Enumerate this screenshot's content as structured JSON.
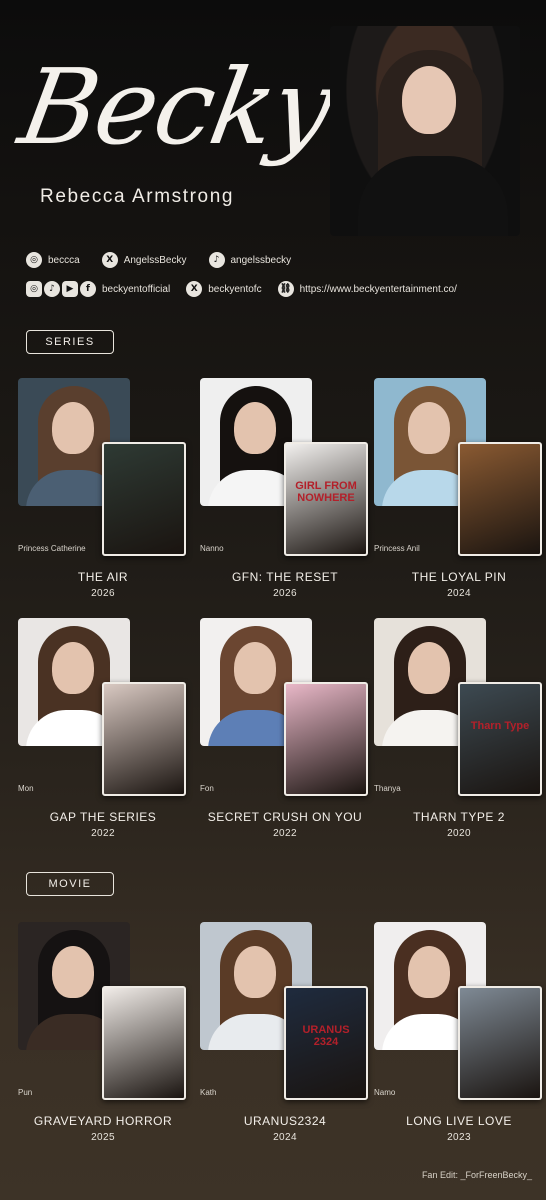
{
  "header": {
    "title": "Becky",
    "full_name": "Rebecca Armstrong"
  },
  "social": {
    "row1": [
      {
        "icon": "instagram-icon",
        "glyph": "◎",
        "handle": "beccca"
      },
      {
        "icon": "x-icon",
        "glyph": "X",
        "handle": "AngelssBecky"
      },
      {
        "icon": "tiktok-icon",
        "glyph": "♪",
        "handle": "angelssbecky"
      }
    ],
    "row2": [
      {
        "icon": "official-accounts-icons",
        "glyphs": [
          "◎",
          "♪",
          "▶",
          "f"
        ],
        "handle": "beckyentofficial"
      },
      {
        "icon": "x-icon",
        "glyph": "X",
        "handle": "beckyentofc"
      },
      {
        "icon": "link-icon",
        "glyph": "🔗",
        "handle": "https://www.beckyentertainment.co/"
      }
    ]
  },
  "sections": {
    "series_label": "SERIES",
    "movie_label": "MOVIE"
  },
  "series": [
    {
      "role": "Princess Catherine",
      "title": "THE AIR",
      "year": "2026",
      "poster_text": "",
      "colors": {
        "bg": "#3a4a56",
        "hair": "#5a3f2e",
        "body": "#4b5f73",
        "poster": "#2e3a34"
      }
    },
    {
      "role": "Nanno",
      "title": "GFN: THE RESET",
      "year": "2026",
      "poster_text": "GIRL FROM NOWHERE",
      "colors": {
        "bg": "#efefef",
        "hair": "#15110f",
        "body": "#f5f5f5",
        "poster": "#f2f0ee"
      }
    },
    {
      "role": "Princess Anil",
      "title": "THE LOYAL PIN",
      "year": "2024",
      "poster_text": "",
      "colors": {
        "bg": "#8fb8cf",
        "hair": "#7a5536",
        "body": "#b8d8ea",
        "poster": "#8a5a32"
      }
    },
    {
      "role": "Mon",
      "title": "GAP THE SERIES",
      "year": "2022",
      "poster_text": "",
      "colors": {
        "bg": "#e9e6e4",
        "hair": "#4a3223",
        "body": "#ffffff",
        "poster": "#d9c9c2"
      }
    },
    {
      "role": "Fon",
      "title": "SECRET CRUSH ON YOU",
      "year": "2022",
      "poster_text": "",
      "colors": {
        "bg": "#f2f0ef",
        "hair": "#6b4631",
        "body": "#5d7fb6",
        "poster": "#e9b8c8"
      }
    },
    {
      "role": "Thanya",
      "title": "THARN TYPE 2",
      "year": "2020",
      "poster_text": "Tharn Type",
      "colors": {
        "bg": "#e6e1da",
        "hair": "#2d1f18",
        "body": "#f5f3f0",
        "poster": "#3d4a52"
      }
    }
  ],
  "movies": [
    {
      "role": "Pun",
      "title": "GRAVEYARD HORROR",
      "year": "2025",
      "poster_text": "",
      "colors": {
        "bg": "#2b2523",
        "hair": "#151212",
        "body": "#3a2c24",
        "poster": "#f1ece8"
      }
    },
    {
      "role": "Kath",
      "title": "URANUS2324",
      "year": "2024",
      "poster_text": "URANUS 2324",
      "colors": {
        "bg": "#bfc7cf",
        "hair": "#5a3b26",
        "body": "#e8ebee",
        "poster": "#1f2b3e"
      }
    },
    {
      "role": "Namo",
      "title": "LONG LIVE LOVE",
      "year": "2023",
      "poster_text": "",
      "colors": {
        "bg": "#f0eeee",
        "hair": "#4a2f21",
        "body": "#ffffff",
        "poster": "#7f8a95"
      }
    }
  ],
  "footer": {
    "credit": "Fan Edit: _ForFreenBecky_"
  }
}
